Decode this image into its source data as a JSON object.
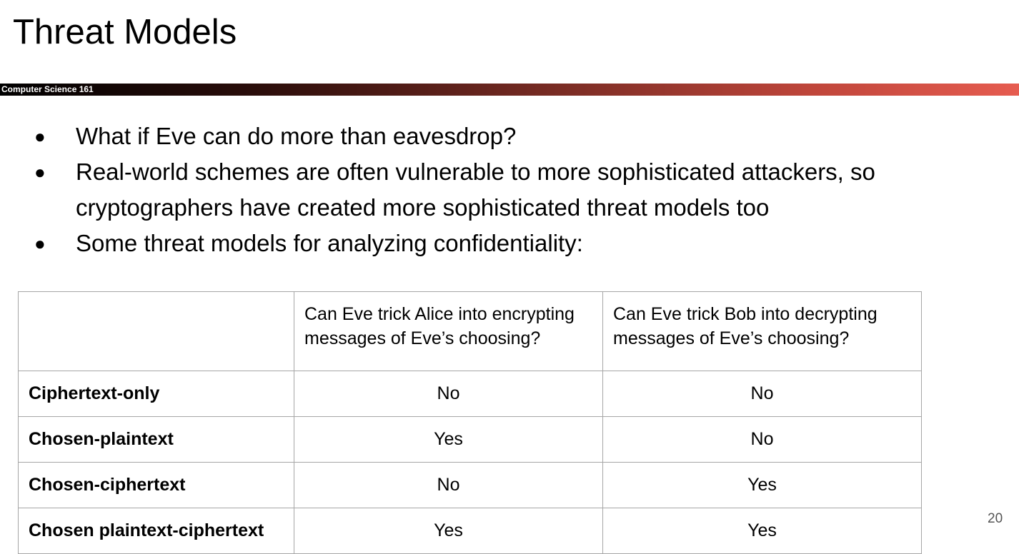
{
  "slide": {
    "title": "Threat Models",
    "course_label": "Computer Science 161",
    "page_number": "20"
  },
  "bullets": [
    {
      "marker": "●",
      "text": "What if Eve can do more than eavesdrop?"
    },
    {
      "marker": "●",
      "text": "Real-world schemes are often vulnerable to more sophisticated attackers, so cryptographers have created more sophisticated threat models too"
    },
    {
      "marker": "●",
      "text": "Some threat models for analyzing confidentiality:"
    }
  ],
  "table": {
    "headers": [
      "",
      "Can Eve trick Alice into encrypting messages of Eve’s choosing?",
      "Can Eve trick Bob into decrypting messages of Eve’s choosing?"
    ],
    "rows": [
      {
        "label": "Ciphertext-only",
        "encrypt": "No",
        "decrypt": "No"
      },
      {
        "label": "Chosen-plaintext",
        "encrypt": "Yes",
        "decrypt": "No"
      },
      {
        "label": "Chosen-ciphertext",
        "encrypt": "No",
        "decrypt": "Yes"
      },
      {
        "label": "Chosen plaintext-ciphertext",
        "encrypt": "Yes",
        "decrypt": "Yes"
      }
    ]
  },
  "colors": {
    "bar_start": "#000000",
    "bar_end": "#e65c50",
    "table_border": "#a6a6a6"
  }
}
